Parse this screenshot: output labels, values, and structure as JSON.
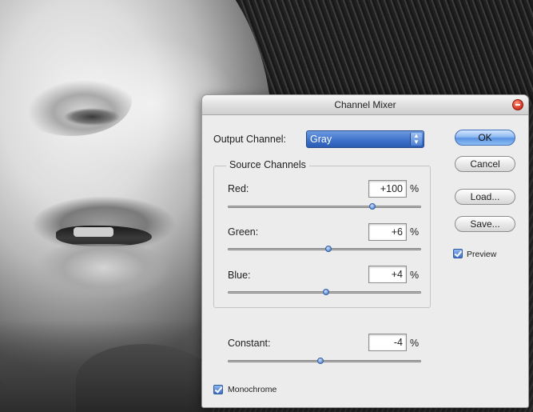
{
  "dialog": {
    "title": "Channel Mixer",
    "output_channel_label": "Output Channel:",
    "output_channel_value": "Gray",
    "source_channels_label": "Source Channels",
    "channels": [
      {
        "label": "Red:",
        "value": "+100",
        "unit": "%",
        "slider_fraction": 0.75
      },
      {
        "label": "Green:",
        "value": "+6",
        "unit": "%",
        "slider_fraction": 0.52
      },
      {
        "label": "Blue:",
        "value": "+4",
        "unit": "%",
        "slider_fraction": 0.51
      }
    ],
    "constant": {
      "label": "Constant:",
      "value": "-4",
      "unit": "%",
      "slider_fraction": 0.48
    },
    "monochrome_label": "Monochrome",
    "monochrome_checked": true,
    "buttons": {
      "ok": "OK",
      "cancel": "Cancel",
      "load": "Load...",
      "save": "Save..."
    },
    "preview_label": "Preview",
    "preview_checked": true
  },
  "icons": {
    "close": "close-icon",
    "select_arrows": "select-arrows-icon",
    "checkbox": "checkmark-icon"
  }
}
